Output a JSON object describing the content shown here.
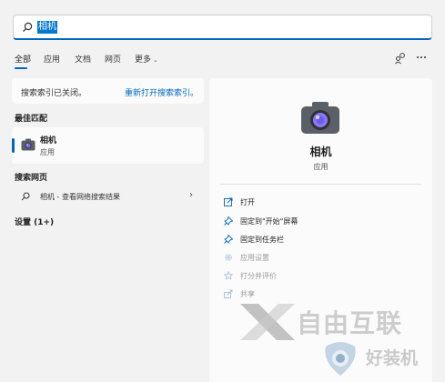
{
  "search": {
    "value": "相机"
  },
  "tabs": [
    {
      "label": "全部",
      "active": true
    },
    {
      "label": "应用"
    },
    {
      "label": "文档"
    },
    {
      "label": "网页"
    },
    {
      "label": "更多"
    }
  ],
  "notice": {
    "text": "搜索索引已关闭。",
    "link": "重新打开搜索索引。"
  },
  "sections": {
    "best_match": "最佳匹配",
    "search_web": "搜索网页",
    "settings": "设置 (1+)"
  },
  "best_match": {
    "name": "相机",
    "type": "应用"
  },
  "web_result": {
    "text": "相机 - 查看网络搜索结果"
  },
  "detail": {
    "name": "相机",
    "type": "应用",
    "actions": [
      {
        "label": "打开",
        "icon": "open-icon",
        "enabled": true
      },
      {
        "label": "固定到\"开始\"屏幕",
        "icon": "pin-icon",
        "enabled": true
      },
      {
        "label": "固定到任务栏",
        "icon": "pin-icon",
        "enabled": true
      },
      {
        "label": "应用设置",
        "icon": "gear-icon",
        "enabled": false
      },
      {
        "label": "打分并评价",
        "icon": "star-icon",
        "enabled": false
      },
      {
        "label": "共享",
        "icon": "share-icon",
        "enabled": false
      }
    ]
  },
  "watermark": {
    "line1": "自由互联",
    "line2": "好装机"
  },
  "colors": {
    "accent": "#0067c0",
    "highlight": "#0078d4",
    "camera_lens": "#7b6cf0"
  }
}
